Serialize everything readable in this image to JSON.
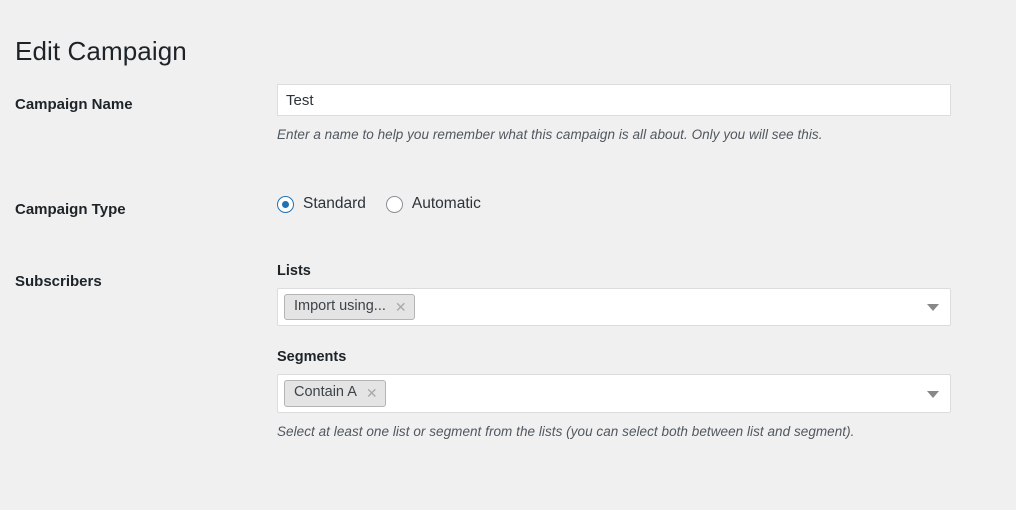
{
  "page": {
    "title": "Edit Campaign"
  },
  "fields": {
    "campaign_name": {
      "label": "Campaign Name",
      "value": "Test",
      "placeholder": "",
      "description": "Enter a name to help you remember what this campaign is all about. Only you will see this."
    },
    "campaign_type": {
      "label": "Campaign Type",
      "selected": "Standard",
      "options": [
        {
          "label": "Standard",
          "checked": true
        },
        {
          "label": "Automatic",
          "checked": false
        }
      ]
    },
    "subscribers": {
      "label": "Subscribers",
      "lists": {
        "label": "Lists",
        "chips": [
          {
            "label": "Import using...",
            "remove_icon": "close-icon"
          }
        ],
        "caret_icon": "chevron-down-icon"
      },
      "segments": {
        "label": "Segments",
        "chips": [
          {
            "label": "Contain A",
            "remove_icon": "close-icon"
          }
        ],
        "caret_icon": "chevron-down-icon"
      },
      "description": "Select at least one list or segment from the lists (you can select both between list and segment)."
    }
  },
  "colors": {
    "background": "#f0f0f1",
    "accent": "#2271b1",
    "text": "#1d2327",
    "muted_text": "#50575e",
    "border": "#dcdcde",
    "chip_background": "#e4e4e4"
  }
}
